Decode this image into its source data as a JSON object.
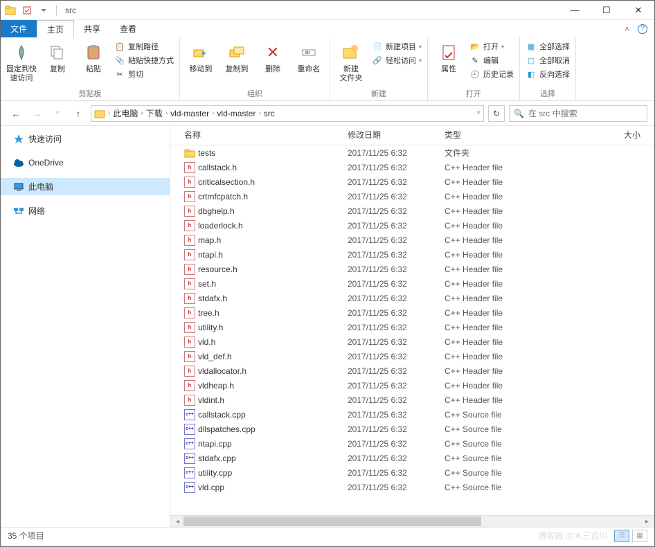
{
  "titlebar": {
    "title": "src"
  },
  "tabs": {
    "file": "文件",
    "home": "主页",
    "share": "共享",
    "view": "查看"
  },
  "ribbon": {
    "clipboard": {
      "pin": "固定到快\n速访问",
      "copy": "复制",
      "paste": "粘贴",
      "copypath": "复制路径",
      "pasteshortcut": "粘贴快捷方式",
      "cut": "剪切",
      "label": "剪贴板"
    },
    "organize": {
      "moveto": "移动到",
      "copyto": "复制到",
      "delete": "删除",
      "rename": "重命名",
      "label": "组织"
    },
    "new": {
      "newfolder": "新建\n文件夹",
      "newitem": "新建项目",
      "easyaccess": "轻松访问",
      "label": "新建"
    },
    "open": {
      "properties": "属性",
      "open": "打开",
      "edit": "编辑",
      "history": "历史记录",
      "label": "打开"
    },
    "select": {
      "selectall": "全部选择",
      "selectnone": "全部取消",
      "invert": "反向选择",
      "label": "选择"
    }
  },
  "breadcrumb": [
    "此电脑",
    "下载",
    "vld-master",
    "vld-master",
    "src"
  ],
  "search": {
    "placeholder": "在 src 中搜索"
  },
  "sidebar": [
    {
      "icon": "star",
      "label": "快速访问",
      "sel": false
    },
    {
      "icon": "cloud",
      "label": "OneDrive",
      "sel": false
    },
    {
      "icon": "pc",
      "label": "此电脑",
      "sel": true
    },
    {
      "icon": "net",
      "label": "网络",
      "sel": false
    }
  ],
  "columns": {
    "name": "名称",
    "date": "修改日期",
    "type": "类型",
    "size": "大小"
  },
  "files": [
    {
      "icon": "folder",
      "name": "tests",
      "date": "2017/11/25 6:32",
      "type": "文件夹"
    },
    {
      "icon": "h",
      "name": "callstack.h",
      "date": "2017/11/25 6:32",
      "type": "C++ Header file"
    },
    {
      "icon": "h",
      "name": "criticalsection.h",
      "date": "2017/11/25 6:32",
      "type": "C++ Header file"
    },
    {
      "icon": "h",
      "name": "crtmfcpatch.h",
      "date": "2017/11/25 6:32",
      "type": "C++ Header file"
    },
    {
      "icon": "h",
      "name": "dbghelp.h",
      "date": "2017/11/25 6:32",
      "type": "C++ Header file"
    },
    {
      "icon": "h",
      "name": "loaderlock.h",
      "date": "2017/11/25 6:32",
      "type": "C++ Header file"
    },
    {
      "icon": "h",
      "name": "map.h",
      "date": "2017/11/25 6:32",
      "type": "C++ Header file"
    },
    {
      "icon": "h",
      "name": "ntapi.h",
      "date": "2017/11/25 6:32",
      "type": "C++ Header file"
    },
    {
      "icon": "h",
      "name": "resource.h",
      "date": "2017/11/25 6:32",
      "type": "C++ Header file"
    },
    {
      "icon": "h",
      "name": "set.h",
      "date": "2017/11/25 6:32",
      "type": "C++ Header file"
    },
    {
      "icon": "h",
      "name": "stdafx.h",
      "date": "2017/11/25 6:32",
      "type": "C++ Header file"
    },
    {
      "icon": "h",
      "name": "tree.h",
      "date": "2017/11/25 6:32",
      "type": "C++ Header file"
    },
    {
      "icon": "h",
      "name": "utility.h",
      "date": "2017/11/25 6:32",
      "type": "C++ Header file"
    },
    {
      "icon": "h",
      "name": "vld.h",
      "date": "2017/11/25 6:32",
      "type": "C++ Header file"
    },
    {
      "icon": "h",
      "name": "vld_def.h",
      "date": "2017/11/25 6:32",
      "type": "C++ Header file"
    },
    {
      "icon": "h",
      "name": "vldallocator.h",
      "date": "2017/11/25 6:32",
      "type": "C++ Header file"
    },
    {
      "icon": "h",
      "name": "vldheap.h",
      "date": "2017/11/25 6:32",
      "type": "C++ Header file"
    },
    {
      "icon": "h",
      "name": "vldint.h",
      "date": "2017/11/25 6:32",
      "type": "C++ Header file"
    },
    {
      "icon": "cpp",
      "name": "callstack.cpp",
      "date": "2017/11/25 6:32",
      "type": "C++ Source file"
    },
    {
      "icon": "cpp",
      "name": "dllspatches.cpp",
      "date": "2017/11/25 6:32",
      "type": "C++ Source file"
    },
    {
      "icon": "cpp",
      "name": "ntapi.cpp",
      "date": "2017/11/25 6:32",
      "type": "C++ Source file"
    },
    {
      "icon": "cpp",
      "name": "stdafx.cpp",
      "date": "2017/11/25 6:32",
      "type": "C++ Source file"
    },
    {
      "icon": "cpp",
      "name": "utility.cpp",
      "date": "2017/11/25 6:32",
      "type": "C++ Source file"
    },
    {
      "icon": "cpp",
      "name": "vld.cpp",
      "date": "2017/11/25 6:32",
      "type": "C++ Source file"
    }
  ],
  "status": {
    "count": "35 个项目",
    "watermark": "博客园 @木三百川"
  }
}
